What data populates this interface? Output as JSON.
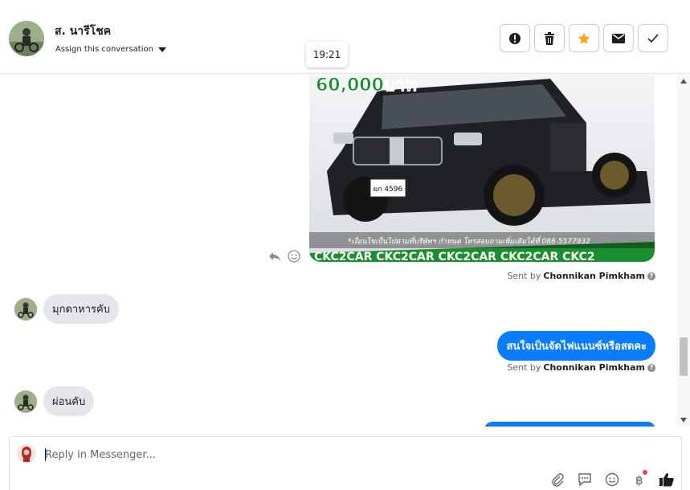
{
  "header": {
    "contact_name": "ส. นารีโชค",
    "assign_label": "Assign this conversation",
    "actions": [
      "spam-icon",
      "trash-icon",
      "star-icon",
      "mail-icon",
      "check-icon"
    ],
    "star_color": "#f5a623"
  },
  "tooltip": {
    "time": "19:21"
  },
  "messages": {
    "image": {
      "price_text": "60,000บาท",
      "plate": "ผก 4596",
      "caption": "*เงื่อนไขเป็นไปตามที่บริษัทฯ กำหนด โทรสอบถามเพิ่มเติมได้ที่ 088-5577932",
      "banner": "CKC2CAR CKC2CAR CKC2CAR CKC2CAR CKC2"
    },
    "sent_by_prefix": "Sent by",
    "sender_name": "Chonnikan Pimkham",
    "incoming_1": "มุกดาหารคับ",
    "outgoing_1": "สนใจเป็นจัดไฟแนนซ์หรือสดคะ",
    "incoming_2": "ผ่อนคับ",
    "accent": "#0a7cff"
  },
  "composer": {
    "placeholder": "Reply in Messenger...",
    "tools": [
      "attach-icon",
      "quick-reply-icon",
      "emoji-icon",
      "payment-icon",
      "like-icon"
    ]
  }
}
